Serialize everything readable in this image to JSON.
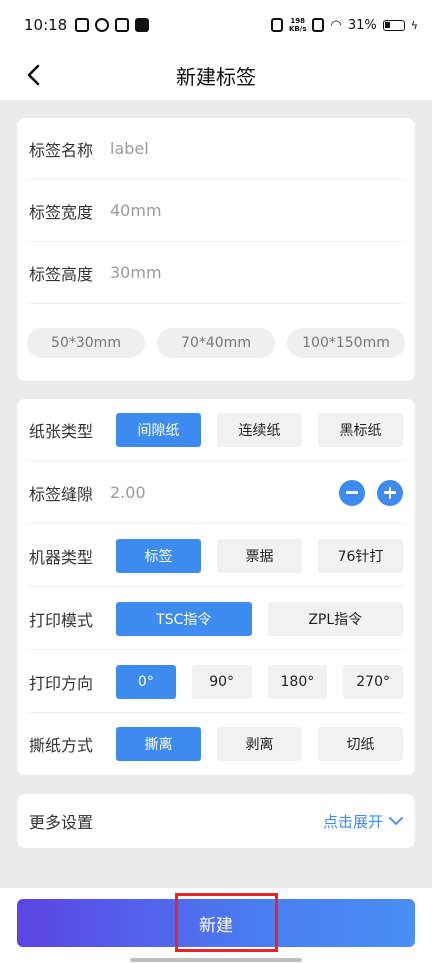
{
  "status_bar": {
    "time": "10:18",
    "net_speed_top": "198",
    "net_speed_unit": "KB/s",
    "battery": "31%"
  },
  "header": {
    "title": "新建标签"
  },
  "card1": {
    "name_label": "标签名称",
    "name_placeholder": "label",
    "width_label": "标签宽度",
    "width_placeholder": "40mm",
    "height_label": "标签高度",
    "height_placeholder": "30mm",
    "presets": [
      "50*30mm",
      "70*40mm",
      "100*150mm"
    ]
  },
  "card2": {
    "paper_type_label": "纸张类型",
    "paper_types": [
      "间隙纸",
      "连续纸",
      "黑标纸"
    ],
    "paper_type_selected": "间隙纸",
    "gap_label": "标签缝隙",
    "gap_value": "2.00",
    "machine_label": "机器类型",
    "machines": [
      "标签",
      "票据",
      "76针打"
    ],
    "machine_selected": "标签",
    "mode_label": "打印模式",
    "modes": [
      "TSC指令",
      "ZPL指令"
    ],
    "mode_selected": "TSC指令",
    "direction_label": "打印方向",
    "directions": [
      "0°",
      "90°",
      "180°",
      "270°"
    ],
    "direction_selected": "0°",
    "tear_label": "撕纸方式",
    "tears": [
      "撕离",
      "剥离",
      "切纸"
    ],
    "tear_selected": "撕离"
  },
  "more": {
    "label": "更多设置",
    "expand": "点击展开"
  },
  "footer": {
    "create_button": "新建"
  },
  "colors": {
    "accent": "#3e8bf0",
    "highlight": "#e8232b"
  }
}
